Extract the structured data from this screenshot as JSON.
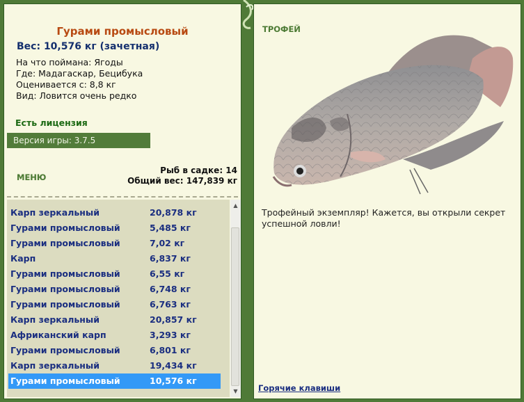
{
  "fish": {
    "name": "Гурами промысловый",
    "weight_line": "Вес: 10,576 кг (зачетная)",
    "bait": "На что поймана: Ягоды",
    "location": "Где: Мадагаскар, Бецибука",
    "valued_from": "Оценивается с: 8,8 кг",
    "rarity": "Вид: Ловится очень редко"
  },
  "license": "Есть лицензия",
  "version": "Версия игры: 3.7.5",
  "menu_label": "МЕНЮ",
  "cage": {
    "count_line": "Рыб в садке: 14",
    "total_line": "Общий вес: 147,839 кг"
  },
  "catch_list": [
    {
      "name": "Карп зеркальный",
      "weight": "20,878 кг"
    },
    {
      "name": "Гурами промысловый",
      "weight": "5,485 кг"
    },
    {
      "name": "Гурами промысловый",
      "weight": "7,02 кг"
    },
    {
      "name": "Карп",
      "weight": "6,837 кг"
    },
    {
      "name": "Гурами промысловый",
      "weight": "6,55 кг"
    },
    {
      "name": "Гурами промысловый",
      "weight": "6,748 кг"
    },
    {
      "name": "Гурами промысловый",
      "weight": "6,763 кг"
    },
    {
      "name": "Карп зеркальный",
      "weight": "20,857 кг"
    },
    {
      "name": "Африканский карп",
      "weight": "3,293 кг"
    },
    {
      "name": "Гурами промысловый",
      "weight": "6,801 кг"
    },
    {
      "name": "Карп зеркальный",
      "weight": "19,434 кг"
    },
    {
      "name": "Гурами промысловый",
      "weight": "10,576 кг"
    }
  ],
  "selected_index": 11,
  "trophy_label": "ТРОФЕЙ",
  "trophy_text": "Трофейный экземпляр! Кажется, вы открыли секрет успешной ловли!",
  "hotkeys_link": "Горячие клавиши",
  "colors": {
    "frame_green": "#4f7a37",
    "panel_bg": "#f8f8e2",
    "title_orange": "#b84a12",
    "list_text_blue": "#1a2e80",
    "selection_blue": "#3399f7"
  }
}
